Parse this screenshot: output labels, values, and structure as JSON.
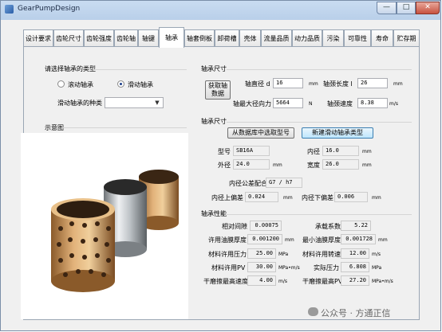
{
  "window": {
    "title": "GearPumpDesign",
    "min": "—",
    "max": "□",
    "close": "✕"
  },
  "tabs": [
    {
      "label": "设计要求"
    },
    {
      "label": "齿轮尺寸"
    },
    {
      "label": "齿轮强度"
    },
    {
      "label": "齿轮轴"
    },
    {
      "label": "轴键"
    },
    {
      "label": "轴承"
    },
    {
      "label": "轴套倒板"
    },
    {
      "label": "卸荷槽"
    },
    {
      "label": "壳体"
    },
    {
      "label": "流量品质"
    },
    {
      "label": "动力品质"
    },
    {
      "label": "污染"
    },
    {
      "label": "可靠性"
    },
    {
      "label": "寿命"
    },
    {
      "label": "贮存期"
    }
  ],
  "left": {
    "type_title": "请选择轴承的类型",
    "rolling_label": "滚动轴承",
    "sliding_label": "滑动轴承",
    "kind_label": "滑动轴承的种类",
    "kind_value": "",
    "diagram_title": "示意图"
  },
  "size": {
    "title": "轴承尺寸",
    "fetch_btn": "获取轴\n数据",
    "shaft_d_label": "轴直径 d",
    "shaft_d": "16",
    "shaft_d_unit": "mm",
    "neck_len_label": "轴颈长度 l",
    "neck_len": "26",
    "neck_len_unit": "mm",
    "radial_force_label": "轴最大径向力",
    "radial_force": "5664",
    "radial_force_unit": "N",
    "shaft_speed_label": "轴颈速度",
    "shaft_speed": "8.38",
    "shaft_speed_unit": "m/s"
  },
  "bearing": {
    "title": "轴承尺寸",
    "select_btn": "从数据库中选取型号",
    "new_btn": "新建滑动轴承类型",
    "model_label": "型号",
    "model": "SB16A",
    "inner_label": "内径",
    "inner": "16.0",
    "inner_unit": "mm",
    "outer_label": "外径",
    "outer": "24.0",
    "outer_unit": "mm",
    "width_label": "宽度",
    "width": "26.0",
    "width_unit": "mm",
    "fit_label": "内径公差配合",
    "fit": "G7 / h7",
    "upper_label": "内径上偏差",
    "upper": "0.024",
    "upper_unit": "mm",
    "lower_label": "内径下偏差",
    "lower": "0.006",
    "lower_unit": "mm"
  },
  "performance": {
    "title": "轴承性能",
    "rel_clear_label": "相对间隙",
    "rel_clear": "0.00075",
    "bearing_coef_label": "承载系数",
    "bearing_coef": "5.22",
    "allow_film_label": "许用油膜厚度",
    "allow_film": "0.001200",
    "allow_film_unit": "mm",
    "min_film_label": "最小油膜厚度",
    "min_film": "0.001728",
    "min_film_unit": "mm",
    "mat_pressure_label": "材料许用压力",
    "mat_pressure": "25.00",
    "mat_pressure_unit": "MPa",
    "mat_speed_label": "材料许用转速",
    "mat_speed": "12.00",
    "mat_speed_unit": "m/s",
    "mat_pv_label": "材料许用PV",
    "mat_pv": "30.00",
    "mat_pv_unit": "MPa•m/s",
    "actual_pressure_label": "实际压力",
    "actual_pressure": "6.808",
    "actual_pressure_unit": "MPa",
    "dry_speed_label": "干磨擦最高速度",
    "dry_speed": "4.00",
    "dry_speed_unit": "m/s",
    "dry_pv_label": "干磨擦最高PV",
    "dry_pv": "27.20",
    "dry_pv_unit": "MPa•m/s"
  },
  "watermark": "公众号 · 方通正信"
}
